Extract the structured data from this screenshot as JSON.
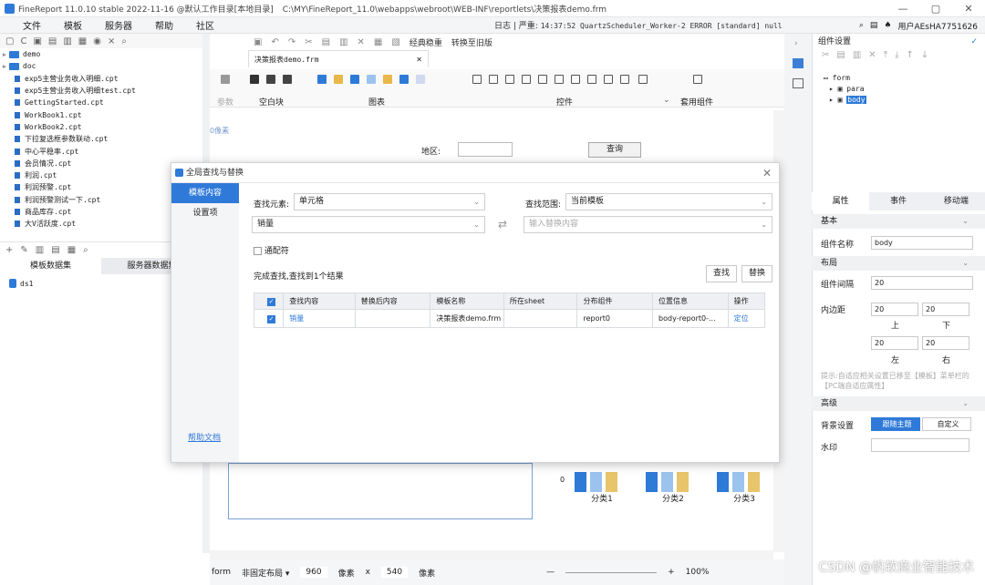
{
  "titlebar": {
    "app": "FineReport 11.0.10 stable 2022-11-16 @默认工作目录[本地目录]",
    "path": "C:\\MY\\FineReport_11.0\\webapps\\webroot\\WEB-INF\\reportlets\\决策报表demo.frm"
  },
  "menu": {
    "items": [
      "文件",
      "模板",
      "服务器",
      "帮助",
      "社区"
    ],
    "log_label": "日志",
    "log_level": "严重:",
    "log_text": "14:37:52 QuartzScheduler_Worker-2 ERROR [standard] null",
    "user": "用户AEsHA7751626"
  },
  "tree": {
    "folders": [
      "demo",
      "doc"
    ],
    "files": [
      "exp5主营业务收入明细.cpt",
      "exp5主营业务收入明细test.cpt",
      "GettingStarted.cpt",
      "WorkBook1.cpt",
      "WorkBook2.cpt",
      "下拉复选框参数联动.cpt",
      "中心平稳率.cpt",
      "会员情况.cpt",
      "利润.cpt",
      "利润预警.cpt",
      "利润预警测试一下.cpt",
      "商品库存.cpt",
      "大V活跃度.cpt"
    ]
  },
  "datasets": {
    "tabs": [
      "模板数据集",
      "服务器数据集"
    ],
    "items": [
      "ds1"
    ]
  },
  "editor": {
    "toolbar_labels": [
      "经典稳重",
      "转换至旧版"
    ],
    "file_tab": "决策报表demo.frm",
    "ribbon": {
      "groups": [
        "参数",
        "空白块",
        "图表",
        "控件",
        "套用组件"
      ]
    },
    "ruler": "0像素",
    "region_label": "地区:",
    "query_button": "查询",
    "chart_categories": [
      "分类1",
      "分类2",
      "分类3"
    ],
    "chart_zero": "0"
  },
  "statusbar": {
    "layout_name": "form",
    "layout_mode": "非固定布局",
    "width": "960",
    "unit1": "像素",
    "x": "x",
    "height": "540",
    "unit2": "像素",
    "zoom": "100%"
  },
  "rightpanel": {
    "title": "组件设置",
    "tree": [
      "form",
      "para",
      "body"
    ],
    "tabs": [
      "属性",
      "事件",
      "移动端"
    ],
    "sections": {
      "basic": "基本",
      "layout": "布局",
      "advanced": "高级"
    },
    "name_label": "组件名称",
    "name_value": "body",
    "gap_label": "组件间隔",
    "gap_value": "20",
    "padding_label": "内边距",
    "pad_top": "20",
    "pad_bottom": "20",
    "pad_left": "20",
    "pad_right": "20",
    "dir_top": "上",
    "dir_bottom": "下",
    "dir_left": "左",
    "dir_right": "右",
    "hint": "提示:自适应相关设置已移至【模板】菜单栏的【PC端自适应属性】",
    "bg_label": "背景设置",
    "bg_theme": "跟随主题",
    "bg_custom": "自定义",
    "watermark_label": "水印"
  },
  "dialog": {
    "title": "全局查找与替换",
    "nav": [
      "模板内容",
      "设置项"
    ],
    "help": "帮助文档",
    "find_elem_label": "查找元素:",
    "find_elem_value": "单元格",
    "scope_label": "查找范围:",
    "scope_value": "当前模板",
    "search_text": "销量",
    "replace_placeholder": "输入替换内容",
    "wildcard": "通配符",
    "status": "完成查找,查找到1个结果",
    "find_btn": "查找",
    "replace_btn": "替换",
    "columns": [
      "查找内容",
      "替换后内容",
      "模板名称",
      "所在sheet",
      "分布组件",
      "位置信息",
      "操作"
    ],
    "rows": [
      {
        "find": "销量",
        "replace": "",
        "template": "决策报表demo.frm",
        "sheet": "",
        "component": "report0",
        "location": "body-report0-...",
        "action": "定位"
      }
    ]
  },
  "watermark_text": "CSDN @帆软商业智能技术",
  "colors": {
    "accent": "#2f7ad9",
    "bar_blue": "#2e7ad7",
    "bar_yellow": "#e8c56a"
  }
}
